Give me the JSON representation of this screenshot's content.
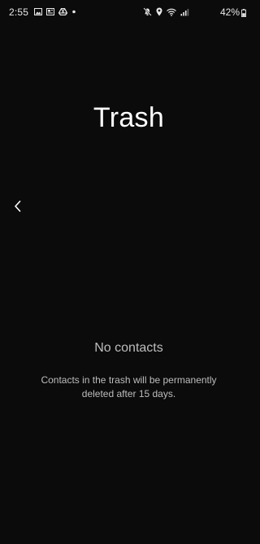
{
  "status_bar": {
    "time": "2:55",
    "battery_percent": "42%",
    "left_icons": [
      "gallery-icon",
      "news-icon",
      "drive-icon",
      "dot-icon"
    ],
    "right_icons": [
      "mute-icon",
      "location-icon",
      "wifi-icon",
      "signal-icon"
    ]
  },
  "header": {
    "title": "Trash"
  },
  "empty_state": {
    "title": "No contacts",
    "description": "Contacts in the trash will be permanently deleted after 15 days."
  }
}
